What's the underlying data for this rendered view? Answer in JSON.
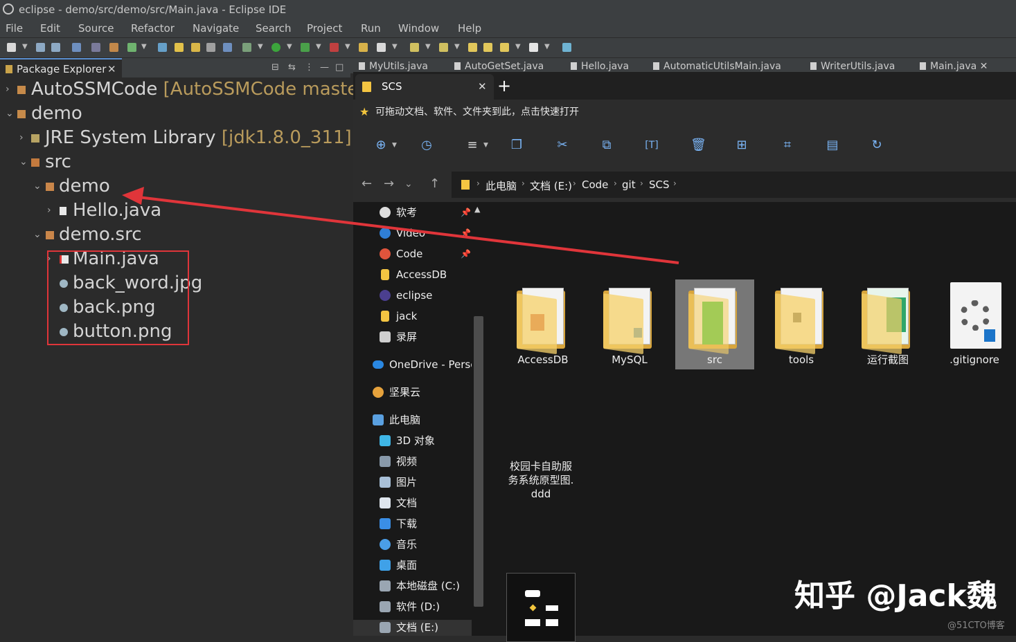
{
  "window": {
    "title": "eclipse - demo/src/demo/src/Main.java - Eclipse IDE"
  },
  "menu": [
    "File",
    "Edit",
    "Source",
    "Refactor",
    "Navigate",
    "Search",
    "Project",
    "Run",
    "Window",
    "Help"
  ],
  "package_explorer": {
    "tab_label": "Package Explorer",
    "close_glyph": "✕",
    "tree": [
      {
        "label": "AutoSSMCode",
        "decoration": "[AutoSSMCode master]",
        "icon": "project-icon",
        "expanded": false
      },
      {
        "label": "demo",
        "decoration": "",
        "icon": "project-icon",
        "expanded": true
      },
      {
        "label": "JRE System Library",
        "decoration": "[jdk1.8.0_311]",
        "icon": "library-icon",
        "expanded": false
      },
      {
        "label": "src",
        "decoration": "",
        "icon": "source-folder-icon",
        "expanded": true
      },
      {
        "label": "demo",
        "decoration": "",
        "icon": "package-icon",
        "expanded": true
      },
      {
        "label": "Hello.java",
        "decoration": "",
        "icon": "java-file-icon",
        "expanded": false
      },
      {
        "label": "demo.src",
        "decoration": "",
        "icon": "package-icon",
        "expanded": true
      },
      {
        "label": "Main.java",
        "decoration": "",
        "icon": "java-file-icon",
        "expanded": false
      },
      {
        "label": "back_word.jpg",
        "decoration": "",
        "icon": "image-file-icon"
      },
      {
        "label": "back.png",
        "decoration": "",
        "icon": "image-file-icon"
      },
      {
        "label": "button.png",
        "decoration": "",
        "icon": "image-file-icon"
      }
    ]
  },
  "editor_tabs": [
    "MyUtils.java",
    "AutoGetSet.java",
    "Hello.java",
    "AutomaticUtilsMain.java",
    "WriterUtils.java",
    "Main.java"
  ],
  "explorer": {
    "tab_title": "SCS",
    "tab_close": "✕",
    "new_tab": "+",
    "hint": "可拖动文档、软件、文件夹到此，点击快速打开",
    "breadcrumbs": [
      "此电脑",
      "文档 (E:)",
      "Code",
      "git",
      "SCS"
    ],
    "quick_access": [
      {
        "label": "软考",
        "pinned": true,
        "icon": "disc-icon"
      },
      {
        "label": "Video",
        "pinned": true,
        "icon": "video-icon"
      },
      {
        "label": "Code",
        "pinned": true,
        "icon": "code-icon"
      },
      {
        "label": "AccessDB",
        "pinned": false,
        "icon": "folder-icon"
      },
      {
        "label": "eclipse",
        "pinned": false,
        "icon": "eclipse-icon"
      },
      {
        "label": "jack",
        "pinned": false,
        "icon": "folder-icon"
      },
      {
        "label": "录屏",
        "pinned": false,
        "icon": "recorder-icon"
      }
    ],
    "onedrive": "OneDrive - Persc",
    "jianguoyun": "坚果云",
    "this_pc": "此电脑",
    "pc_items": [
      {
        "label": "3D 对象",
        "icon": "cube-icon"
      },
      {
        "label": "视频",
        "icon": "film-icon"
      },
      {
        "label": "图片",
        "icon": "picture-icon"
      },
      {
        "label": "文档",
        "icon": "document-icon"
      },
      {
        "label": "下载",
        "icon": "download-icon"
      },
      {
        "label": "音乐",
        "icon": "music-icon"
      },
      {
        "label": "桌面",
        "icon": "desktop-icon"
      },
      {
        "label": "本地磁盘 (C:)",
        "icon": "drive-icon"
      },
      {
        "label": "软件 (D:)",
        "icon": "drive-icon"
      },
      {
        "label": "文档 (E:)",
        "icon": "drive-icon"
      }
    ],
    "files": [
      {
        "name": "AccessDB",
        "type": "folder",
        "accent": "#c0392b"
      },
      {
        "name": "MySQL",
        "type": "folder",
        "accent": "#1b74c9"
      },
      {
        "name": "src",
        "type": "folder",
        "accent": "#27c23a",
        "selected": true
      },
      {
        "name": "tools",
        "type": "folder",
        "accent": "#444444"
      },
      {
        "name": "运行截图",
        "type": "folder",
        "accent": "#2ea66a"
      },
      {
        "name": ".gitignore",
        "type": "file",
        "accent": "#1b74c9"
      },
      {
        "name": "校园卡自助服务系统原型图.ddd",
        "type": "ddd",
        "accent": "#f2c53d",
        "lines": [
          "校园卡自助服",
          "务系统原型图.",
          "ddd"
        ]
      }
    ]
  },
  "watermark": {
    "main": "知乎 @Jack魏",
    "sub": "@51CTO博客"
  },
  "colors": {
    "annotation_red": "#e0353a",
    "folder_yellow": "#f7d169",
    "eclipse_bg": "#2b2b2b",
    "explorer_bg": "#191919"
  }
}
